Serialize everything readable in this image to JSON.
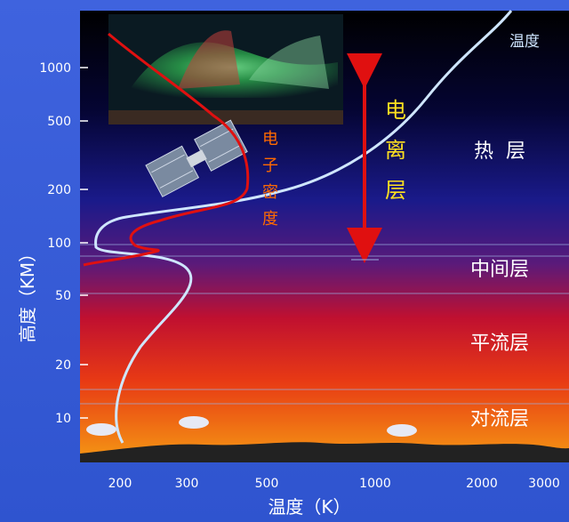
{
  "axes": {
    "y_label": "高度（KM）",
    "x_label": "温度（K）",
    "y_ticks": [
      "1000",
      "500",
      "200",
      "100",
      "50",
      "20",
      "10"
    ],
    "x_ticks": [
      "200",
      "300",
      "500",
      "1000",
      "2000",
      "3000"
    ]
  },
  "layers": {
    "thermosphere": "热  层",
    "mesosphere": "中间层",
    "stratosphere": "平流层",
    "troposphere": "对流层"
  },
  "curves": {
    "temperature_label": "温度",
    "electron_density_chars": [
      "电",
      "子",
      "密",
      "度"
    ]
  },
  "ionosphere_chars": [
    "电",
    "离",
    "层"
  ],
  "colors": {
    "frame_bg": "#3a5fd8",
    "space_top": "#000000",
    "atmosphere_bottom": "#f08a10",
    "temperature_curve": "#cfe6ff",
    "electron_curve": "#e01010",
    "ionosphere_text": "#ffe020",
    "electron_text": "#ff6a00",
    "arrow": "#e01010"
  }
}
